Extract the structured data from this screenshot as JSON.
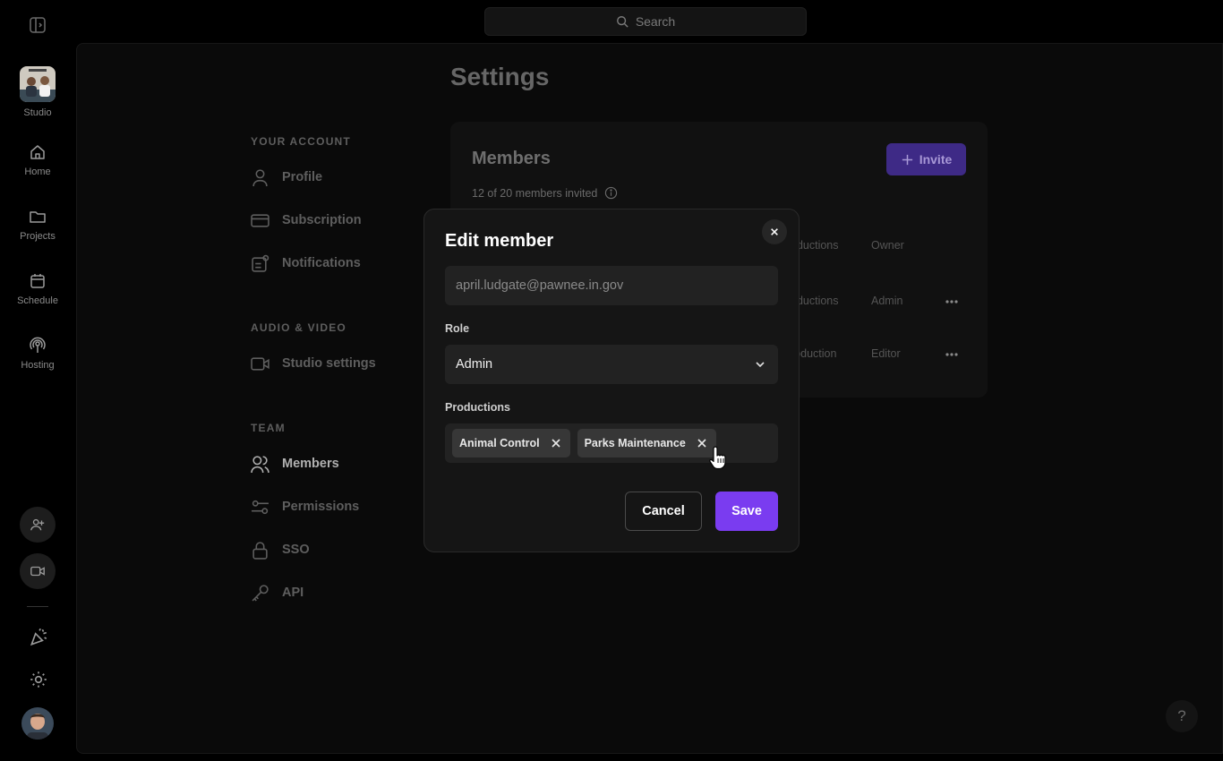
{
  "search": {
    "placeholder": "Search"
  },
  "rail": {
    "studio_label": "Studio",
    "items": [
      {
        "label": "Home",
        "icon": "home-icon"
      },
      {
        "label": "Projects",
        "icon": "folder-icon"
      },
      {
        "label": "Schedule",
        "icon": "calendar-icon"
      },
      {
        "label": "Hosting",
        "icon": "podcast-icon"
      }
    ]
  },
  "page": {
    "title": "Settings"
  },
  "settings_nav": {
    "sections": [
      {
        "title": "YOUR ACCOUNT",
        "items": [
          "Profile",
          "Subscription",
          "Notifications"
        ]
      },
      {
        "title": "AUDIO & VIDEO",
        "items": [
          "Studio settings"
        ]
      },
      {
        "title": "TEAM",
        "items": [
          "Members",
          "Permissions",
          "SSO",
          "API"
        ]
      }
    ],
    "active": "Members"
  },
  "members_card": {
    "title": "Members",
    "subtitle": "12 of 20 members invited",
    "invite_label": "Invite",
    "rows": [
      {
        "productions": "oductions",
        "role": "Owner"
      },
      {
        "productions": "oductions",
        "role": "Admin"
      },
      {
        "productions": "roduction",
        "role": "Editor"
      }
    ]
  },
  "modal": {
    "title": "Edit member",
    "email_value": "april.ludgate@pawnee.in.gov",
    "role_label": "Role",
    "role_value": "Admin",
    "productions_label": "Productions",
    "productions": [
      "Animal Control",
      "Parks Maintenance"
    ],
    "cancel_label": "Cancel",
    "save_label": "Save"
  },
  "help": {
    "label": "?"
  },
  "colors": {
    "accent": "#7a3cf0",
    "invite_bg": "#3e2a86"
  }
}
